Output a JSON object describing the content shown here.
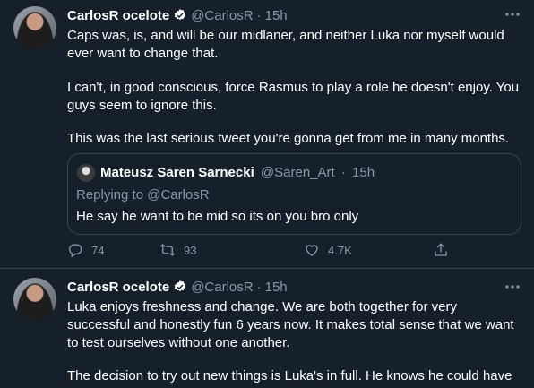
{
  "tweets": [
    {
      "name": "CarlosR ocelote",
      "handle": "@CarlosR",
      "time": "15h",
      "paragraphs": [
        "Caps was, is, and will be our midlaner, and neither Luka nor myself would ever want to change that.",
        "I can't, in good conscious, force Rasmus to play a role he doesn't enjoy. You guys seem to ignore this.",
        "This was the last serious tweet you're gonna get from me in many months."
      ],
      "quote": {
        "name": "Mateusz Saren Sarnecki",
        "handle": "@Saren_Art",
        "time": "15h",
        "replying_prefix": "Replying to ",
        "replying_to": "@CarlosR",
        "text": "He say he want to be mid so its on you bro only"
      },
      "actions": {
        "replies": "74",
        "retweets": "93",
        "likes": "4.7K"
      }
    },
    {
      "name": "CarlosR ocelote",
      "handle": "@CarlosR",
      "time": "15h",
      "paragraphs": [
        "Luka enjoys freshness and change. We are both together for very successful and honestly fun 6 years now. It makes total sense that we want to test ourselves without one another.",
        "The decision to try out new things is Luka's in full. He knows he could have"
      ]
    }
  ],
  "separator": "·",
  "colors": {
    "background": "#15202b",
    "muted": "#8899a6",
    "border": "#38444d",
    "verified": "#1da1f2"
  },
  "icons": [
    "verified-badge-icon",
    "more-icon",
    "reply-icon",
    "retweet-icon",
    "like-icon",
    "share-icon"
  ]
}
